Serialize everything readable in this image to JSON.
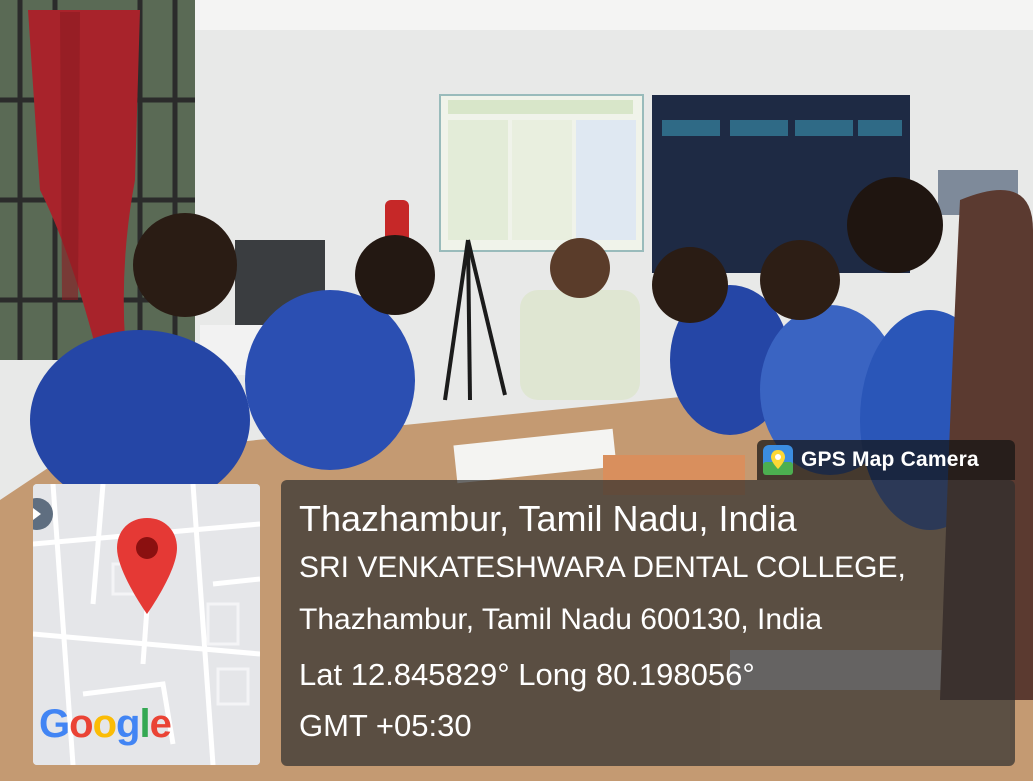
{
  "badge": {
    "app_name": "GPS Map Camera",
    "icon": "map-pin-app-icon"
  },
  "location": {
    "city_line": "Thazhambur, Tamil Nadu, India",
    "place_name": "SRI VENKATESHWARA DENTAL COLLEGE,",
    "address": "Thazhambur, Tamil Nadu 600130, India",
    "coordinates": "Lat 12.845829° Long 80.198056°",
    "timezone": "GMT +05:30"
  },
  "map": {
    "logo_text": [
      "G",
      "o",
      "o",
      "g",
      "l",
      "e"
    ],
    "logo_colors": [
      "#4285F4",
      "#EA4335",
      "#FBBC05",
      "#4285F4",
      "#34A853",
      "#EA4335"
    ],
    "marker_color": "#E53935"
  },
  "photo_description_colors": {
    "scrubs": "#2546a6",
    "wall": "#e9eaea",
    "curtain": "#a8232b",
    "table": "#c49a72"
  }
}
